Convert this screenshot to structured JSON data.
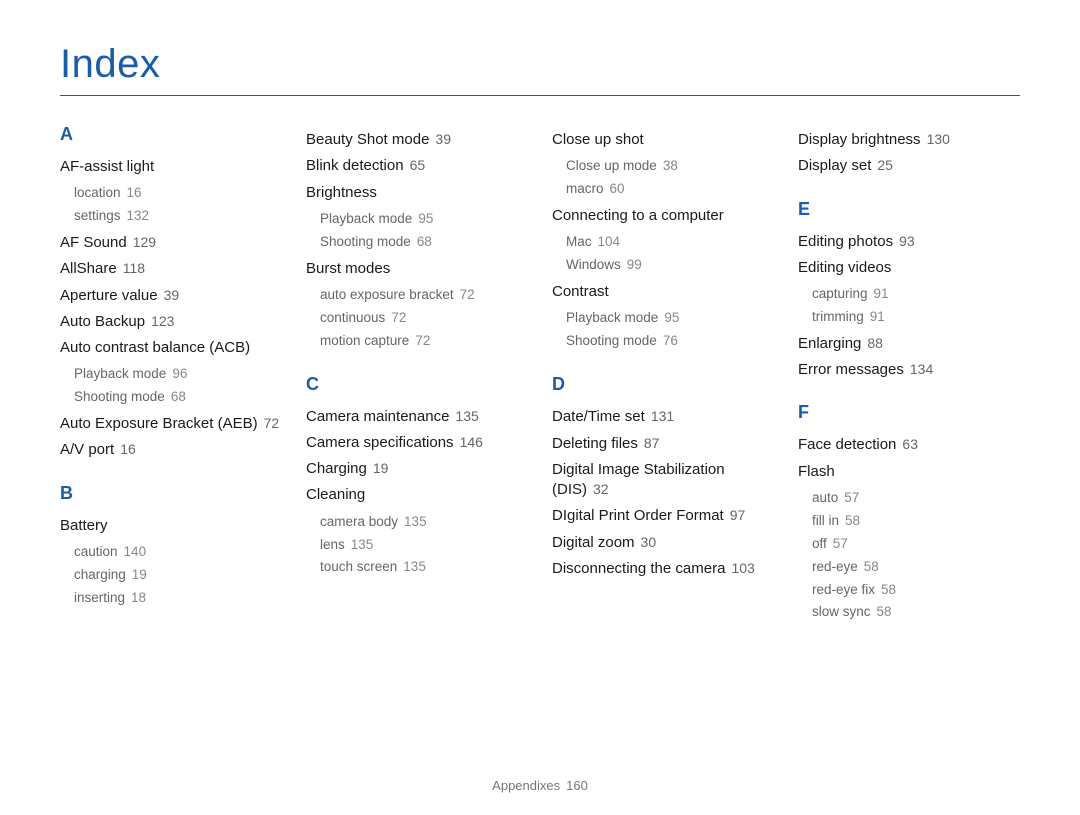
{
  "title": "Index",
  "footer": {
    "label": "Appendixes",
    "page": "160"
  },
  "columns": [
    {
      "blocks": [
        {
          "type": "letter",
          "text": "A"
        },
        {
          "type": "entry",
          "label": "AF-assist light"
        },
        {
          "type": "sub",
          "label": "location",
          "page": "16"
        },
        {
          "type": "sub",
          "label": "settings",
          "page": "132"
        },
        {
          "type": "entry",
          "label": "AF Sound",
          "page": "129"
        },
        {
          "type": "entry",
          "label": "AllShare",
          "page": "118"
        },
        {
          "type": "entry",
          "label": "Aperture value",
          "page": "39"
        },
        {
          "type": "entry",
          "label": "Auto Backup",
          "page": "123"
        },
        {
          "type": "entry",
          "label": "Auto contrast balance (ACB)"
        },
        {
          "type": "sub",
          "label": "Playback mode",
          "page": "96"
        },
        {
          "type": "sub",
          "label": "Shooting mode",
          "page": "68"
        },
        {
          "type": "entry",
          "label": "Auto Exposure Bracket (AEB)",
          "page": "72"
        },
        {
          "type": "entry",
          "label": "A/V port",
          "page": "16"
        },
        {
          "type": "letter",
          "text": "B"
        },
        {
          "type": "entry",
          "label": "Battery"
        },
        {
          "type": "sub",
          "label": "caution",
          "page": "140"
        },
        {
          "type": "sub",
          "label": "charging",
          "page": "19"
        },
        {
          "type": "sub",
          "label": "inserting",
          "page": "18"
        }
      ]
    },
    {
      "blocks": [
        {
          "type": "entry",
          "label": "Beauty Shot mode",
          "page": "39"
        },
        {
          "type": "entry",
          "label": "Blink detection",
          "page": "65"
        },
        {
          "type": "entry",
          "label": "Brightness"
        },
        {
          "type": "sub",
          "label": "Playback mode",
          "page": "95"
        },
        {
          "type": "sub",
          "label": "Shooting mode",
          "page": "68"
        },
        {
          "type": "entry",
          "label": "Burst modes"
        },
        {
          "type": "sub",
          "label": "auto exposure bracket",
          "page": "72"
        },
        {
          "type": "sub",
          "label": "continuous",
          "page": "72"
        },
        {
          "type": "sub",
          "label": "motion capture",
          "page": "72"
        },
        {
          "type": "letter",
          "text": "C"
        },
        {
          "type": "entry",
          "label": "Camera maintenance",
          "page": "135"
        },
        {
          "type": "entry",
          "label": "Camera speciﬁcations",
          "page": "146"
        },
        {
          "type": "entry",
          "label": "Charging",
          "page": "19"
        },
        {
          "type": "entry",
          "label": "Cleaning"
        },
        {
          "type": "sub",
          "label": "camera body",
          "page": "135"
        },
        {
          "type": "sub",
          "label": "lens",
          "page": "135"
        },
        {
          "type": "sub",
          "label": "touch screen",
          "page": "135"
        }
      ]
    },
    {
      "blocks": [
        {
          "type": "entry",
          "label": "Close up shot"
        },
        {
          "type": "sub",
          "label": "Close up mode",
          "page": "38"
        },
        {
          "type": "sub",
          "label": "macro",
          "page": "60"
        },
        {
          "type": "entry",
          "label": "Connecting to a computer"
        },
        {
          "type": "sub",
          "label": "Mac",
          "page": "104"
        },
        {
          "type": "sub",
          "label": "Windows",
          "page": "99"
        },
        {
          "type": "entry",
          "label": "Contrast"
        },
        {
          "type": "sub",
          "label": "Playback mode",
          "page": "95"
        },
        {
          "type": "sub",
          "label": "Shooting mode",
          "page": "76"
        },
        {
          "type": "letter",
          "text": "D"
        },
        {
          "type": "entry",
          "label": "Date/Time set",
          "page": "131"
        },
        {
          "type": "entry",
          "label": "Deleting ﬁles",
          "page": "87"
        },
        {
          "type": "entry",
          "label": "Digital Image Stabilization (DIS)",
          "page": "32"
        },
        {
          "type": "entry",
          "label": "DIgital Print Order Format",
          "page": "97"
        },
        {
          "type": "entry",
          "label": "Digital zoom",
          "page": "30"
        },
        {
          "type": "entry",
          "label": "Disconnecting the camera",
          "page": "103"
        }
      ]
    },
    {
      "blocks": [
        {
          "type": "entry",
          "label": "Display brightness",
          "page": "130"
        },
        {
          "type": "entry",
          "label": "Display set",
          "page": "25"
        },
        {
          "type": "letter",
          "text": "E"
        },
        {
          "type": "entry",
          "label": "Editing photos",
          "page": "93"
        },
        {
          "type": "entry",
          "label": "Editing videos"
        },
        {
          "type": "sub",
          "label": "capturing",
          "page": "91"
        },
        {
          "type": "sub",
          "label": "trimming",
          "page": "91"
        },
        {
          "type": "entry",
          "label": "Enlarging",
          "page": "88"
        },
        {
          "type": "entry",
          "label": "Error messages",
          "page": "134"
        },
        {
          "type": "letter",
          "text": "F"
        },
        {
          "type": "entry",
          "label": "Face detection",
          "page": "63"
        },
        {
          "type": "entry",
          "label": "Flash"
        },
        {
          "type": "sub",
          "label": "auto",
          "page": "57"
        },
        {
          "type": "sub",
          "label": "ﬁll in",
          "page": "58"
        },
        {
          "type": "sub",
          "label": "off",
          "page": "57"
        },
        {
          "type": "sub",
          "label": "red-eye",
          "page": "58"
        },
        {
          "type": "sub",
          "label": "red-eye ﬁx",
          "page": "58"
        },
        {
          "type": "sub",
          "label": "slow sync",
          "page": "58"
        }
      ]
    }
  ]
}
